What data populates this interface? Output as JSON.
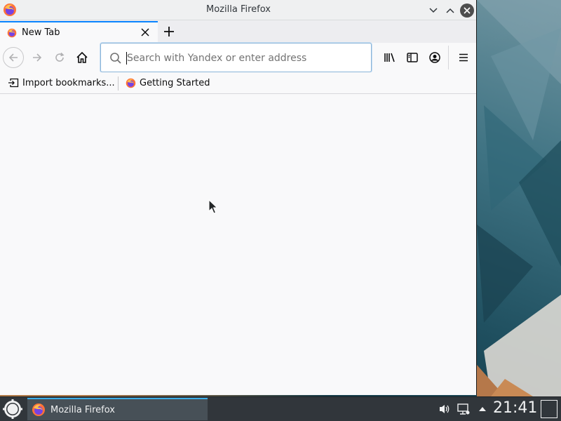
{
  "window": {
    "title": "Mozilla Firefox",
    "app_icon": "firefox-icon",
    "controls": {
      "minimize": "chevron-down-icon",
      "maximize": "chevron-up-icon",
      "close": "close-icon"
    }
  },
  "tabs": [
    {
      "label": "New Tab",
      "icon": "firefox-icon",
      "active": true
    }
  ],
  "toolbar": {
    "urlbar_placeholder": "Search with Yandex or enter address",
    "urlbar_value": ""
  },
  "bookmarks": {
    "import_label": "Import bookmarks...",
    "items": [
      {
        "label": "Getting Started",
        "icon": "firefox-icon"
      }
    ]
  },
  "taskbar": {
    "task_label": "Mozilla Firefox",
    "clock": "21:41"
  },
  "colors": {
    "accent": "#0a84ff",
    "taskbar_bg": "#31363b",
    "task_highlight": "#3daee9"
  }
}
